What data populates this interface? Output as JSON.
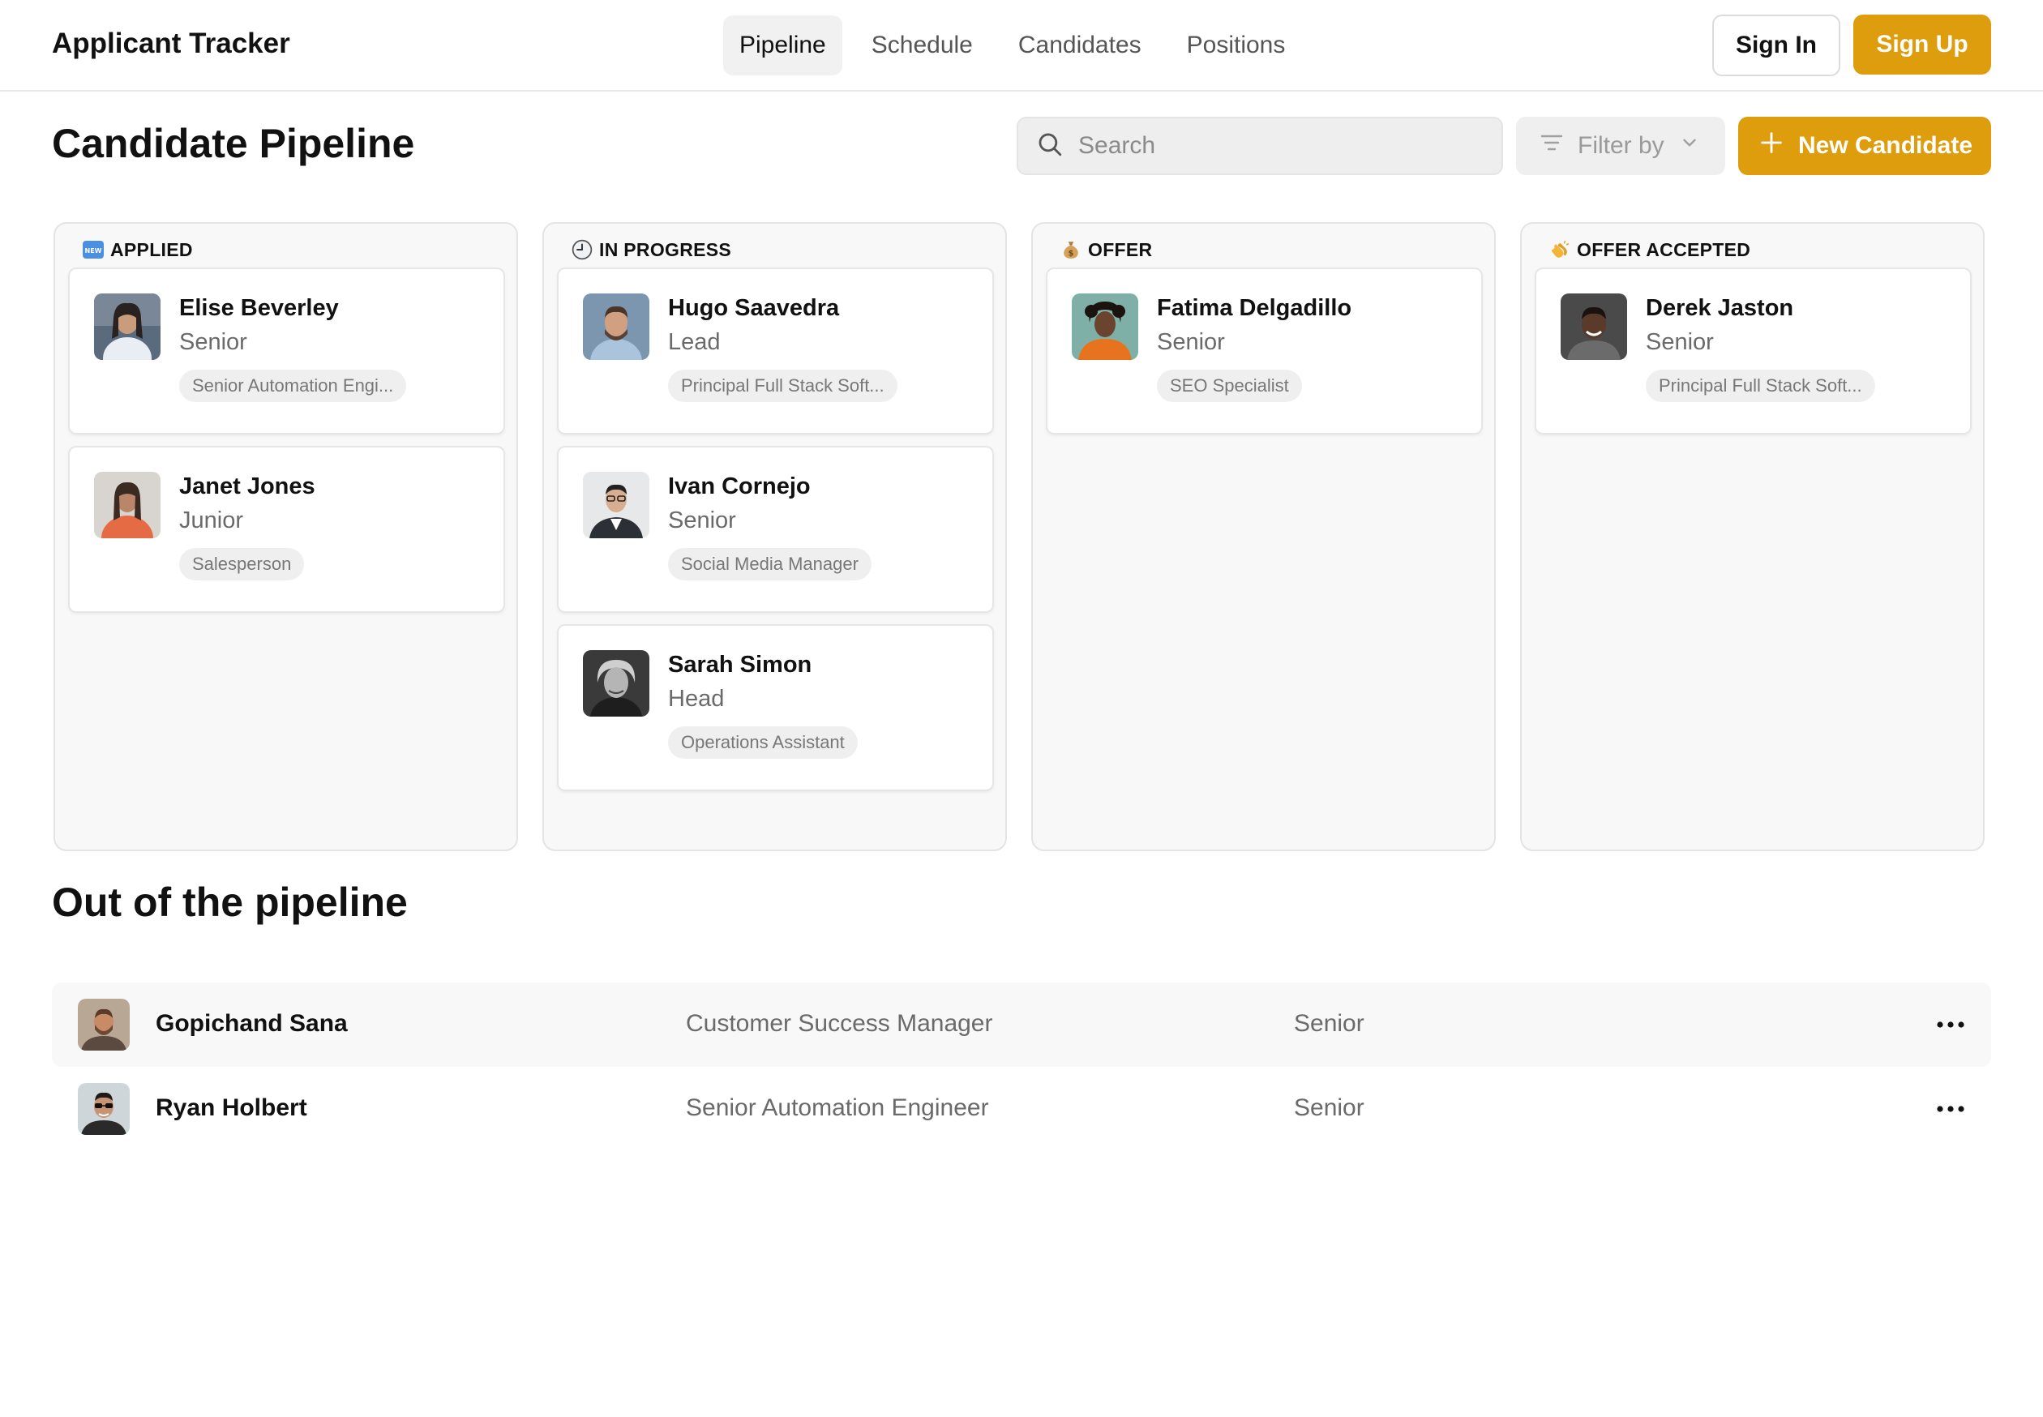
{
  "header": {
    "app_title": "Applicant Tracker",
    "nav": [
      {
        "label": "Pipeline",
        "active": true
      },
      {
        "label": "Schedule",
        "active": false
      },
      {
        "label": "Candidates",
        "active": false
      },
      {
        "label": "Positions",
        "active": false
      }
    ],
    "sign_in": "Sign In",
    "sign_up": "Sign Up"
  },
  "toolbar": {
    "page_title": "Candidate Pipeline",
    "search_placeholder": "Search",
    "filter_label": "Filter by",
    "new_candidate_label": "New Candidate"
  },
  "colors": {
    "accent": "#dd9d0c",
    "column_bg": "#f8f8f8",
    "tag_bg": "#efefef"
  },
  "pipeline": {
    "columns": [
      {
        "title": "APPLIED",
        "icon": "new-badge-icon",
        "cards": [
          {
            "name": "Elise Beverley",
            "level": "Senior",
            "position": "Senior Automation Engi...",
            "avatar": "woman-white-shirt"
          },
          {
            "name": "Janet Jones",
            "level": "Junior",
            "position": "Salesperson",
            "avatar": "woman-orange-top"
          }
        ]
      },
      {
        "title": "IN PROGRESS",
        "icon": "clock-icon",
        "cards": [
          {
            "name": "Hugo Saavedra",
            "level": "Lead",
            "position": "Principal Full Stack Soft...",
            "avatar": "man-beard-blue-shirt"
          },
          {
            "name": "Ivan Cornejo",
            "level": "Senior",
            "position": "Social Media Manager",
            "avatar": "man-glasses-suit"
          },
          {
            "name": "Sarah Simon",
            "level": "Head",
            "position": "Operations Assistant",
            "avatar": "older-woman-grayscale"
          }
        ]
      },
      {
        "title": "OFFER",
        "icon": "money-bag-icon",
        "cards": [
          {
            "name": "Fatima Delgadillo",
            "level": "Senior",
            "position": "SEO Specialist",
            "avatar": "woman-orange-jacket"
          }
        ]
      },
      {
        "title": "OFFER ACCEPTED",
        "icon": "clapping-hands-icon",
        "cards": [
          {
            "name": "Derek Jaston",
            "level": "Senior",
            "position": "Principal Full Stack Soft...",
            "avatar": "man-smiling-dark"
          }
        ]
      }
    ]
  },
  "out_of_pipeline": {
    "title": "Out of the pipeline",
    "rows": [
      {
        "name": "Gopichand Sana",
        "position": "Customer Success Manager",
        "level": "Senior",
        "avatar": "man-beard-tan"
      },
      {
        "name": "Ryan Holbert",
        "position": "Senior Automation Engineer",
        "level": "Senior",
        "avatar": "man-sunglasses"
      }
    ]
  }
}
